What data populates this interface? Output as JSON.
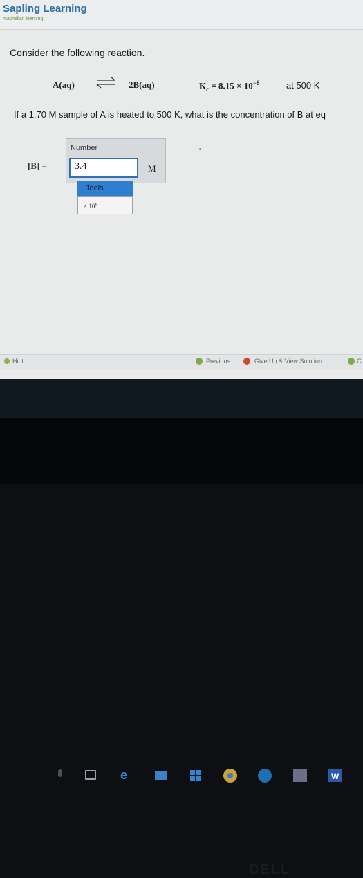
{
  "header": {
    "logo_title": "Sapling Learning",
    "logo_sub": "macmillan learning"
  },
  "question": {
    "title": "Consider the following reaction.",
    "reactant": "A(aq)",
    "product": "2B(aq)",
    "k_symbol": "K",
    "k_subscript": "c",
    "k_value": "= 8.15 × 10",
    "k_exponent": "−6",
    "temperature": "at 500 K",
    "prompt": "If a 1.70 M sample of A is heated to 500 K, what is the concentration of B at eq"
  },
  "answer": {
    "number_label": "Number",
    "variable_label": "[B] =",
    "value": "3.4",
    "unit": "M",
    "tools_label": "Tools",
    "x10_label": "× 10",
    "x10_exp": "y"
  },
  "footer": {
    "hint": "Hint",
    "previous": "Previous",
    "give_up": "Give Up & View Solution",
    "continue": "C"
  },
  "bezel": {
    "brand": "DELL"
  },
  "colors": {
    "logo": "#2e6fa8",
    "input_border": "#2f6fb3",
    "tools_button": "#2f7fd0",
    "taskbar": "#101820"
  }
}
